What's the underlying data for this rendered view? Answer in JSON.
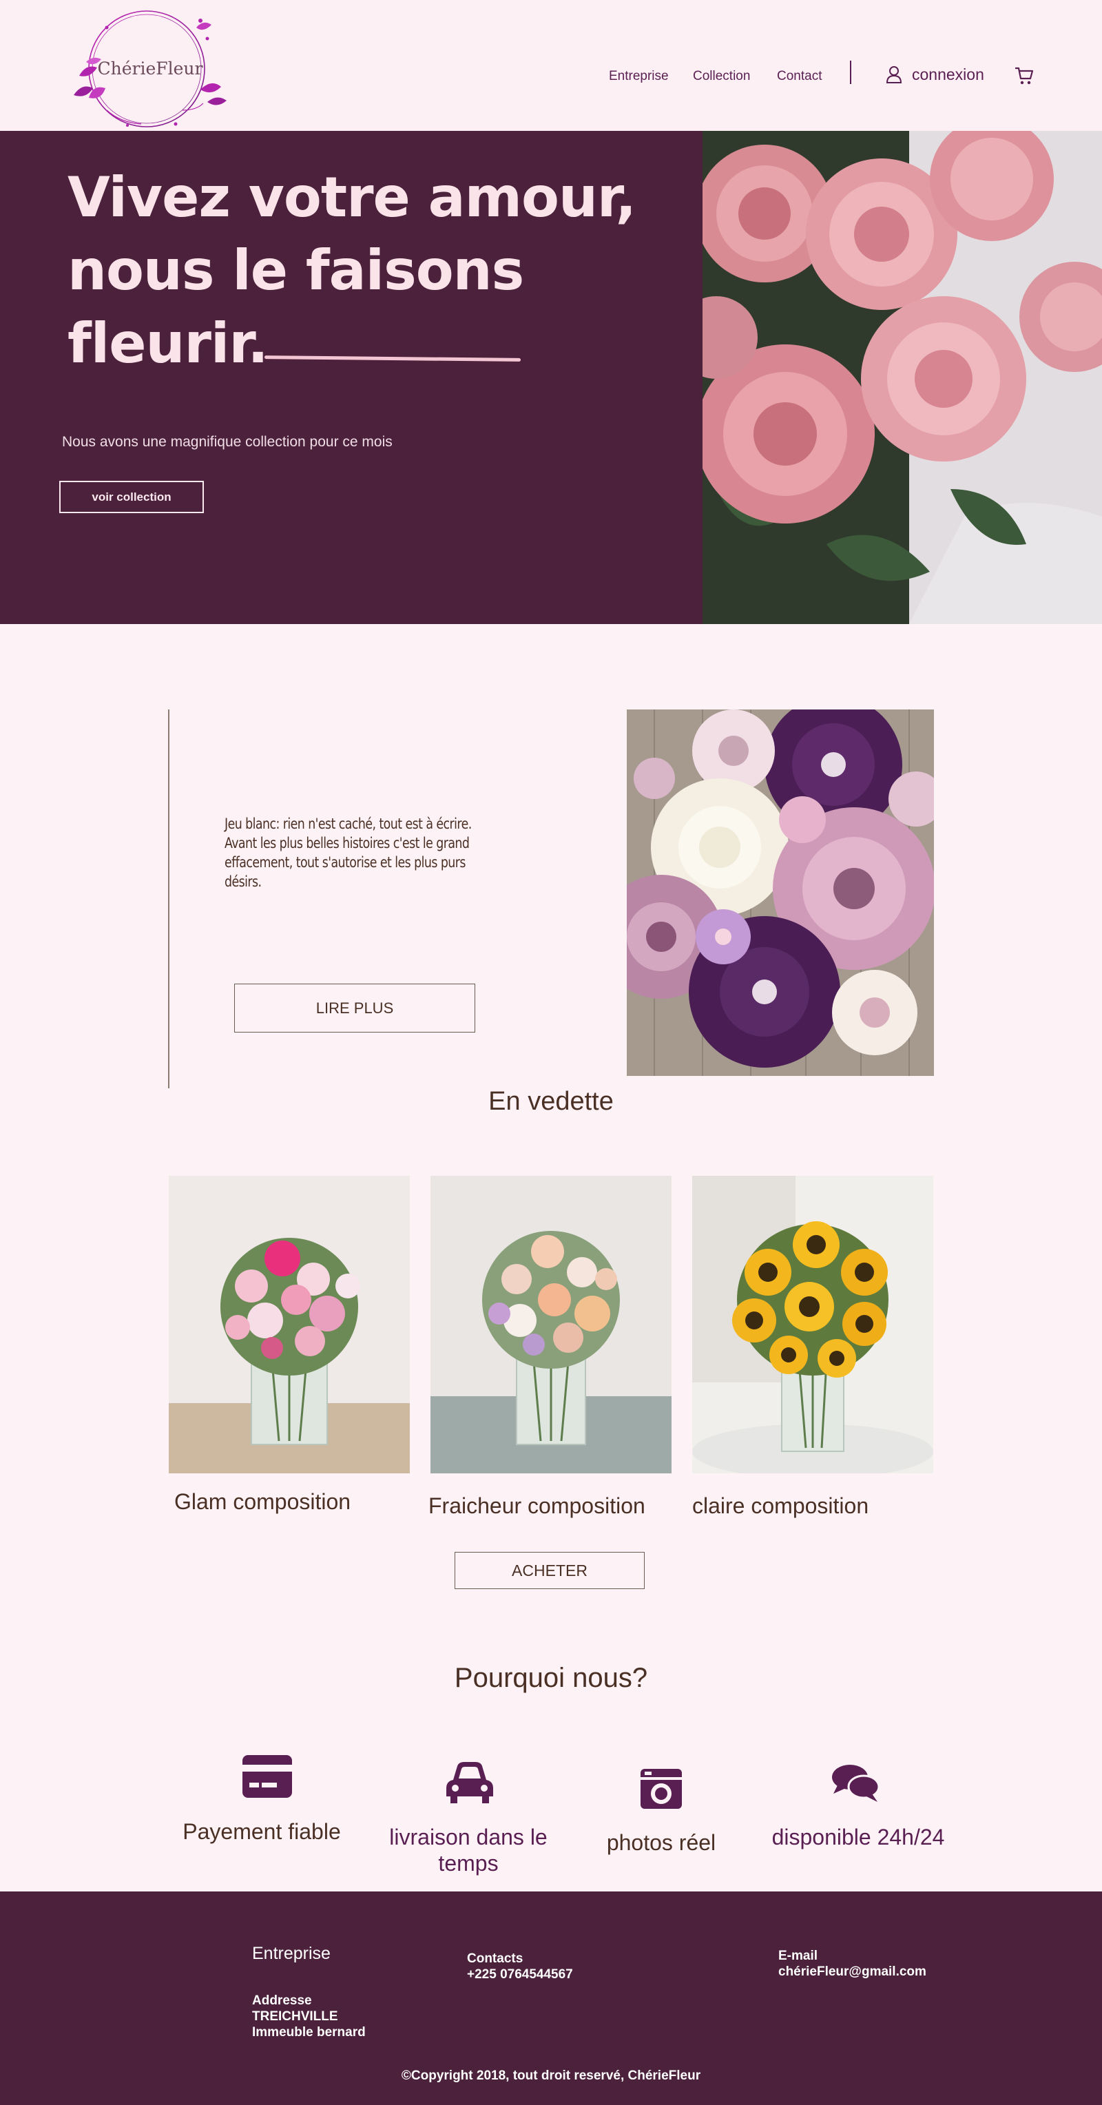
{
  "colors": {
    "brand_dark": "#4b213b",
    "brand_purple": "#5a1f52",
    "hero_text": "#fbe3ea",
    "page_bg": "#fdf3f6",
    "body_text": "#4a2f25"
  },
  "header": {
    "logo_text": "ChérieFleur",
    "nav": [
      "Entreprise",
      "Collection",
      "Contact"
    ],
    "login_label": "connexion",
    "login_icon": "user-icon",
    "cart_icon": "cart-icon"
  },
  "hero": {
    "title": "Vivez votre amour, nous le faisons fleurir.",
    "subtitle": "Nous avons une magnifique collection pour ce mois",
    "button": "voir collection"
  },
  "about": {
    "text": "Jeu blanc: rien n'est caché, tout est à écrire. Avant les plus belles histoires c'est le grand effacement, tout s'autorise et les plus purs désirs.",
    "button": "LIRE PLUS"
  },
  "featured": {
    "title": "En vedette",
    "products": [
      {
        "name": "Glam composition"
      },
      {
        "name": "Fraicheur composition"
      },
      {
        "name": "claire composition"
      }
    ],
    "buy_button": "ACHETER"
  },
  "why": {
    "title": "Pourquoi nous?",
    "items": [
      {
        "label": "Payement fiable",
        "icon": "credit-card-icon",
        "color": "#4a2f25"
      },
      {
        "label": "livraison dans le temps",
        "icon": "car-icon",
        "color": "#5a1f52"
      },
      {
        "label": "photos réel",
        "icon": "camera-icon",
        "color": "#4a2f25"
      },
      {
        "label": "disponible 24h/24",
        "icon": "chat-icon",
        "color": "#5a1f52"
      }
    ]
  },
  "footer": {
    "company_heading": "Entreprise",
    "address": "Addresse\nTREICHVILLE\nImmeuble bernard",
    "contacts": "Contacts\n+225 0764544567",
    "email": "E-mail\nchérieFleur@gmail.com",
    "copyright": "©Copyright 2018, tout droit reservé, ChérieFleur"
  }
}
